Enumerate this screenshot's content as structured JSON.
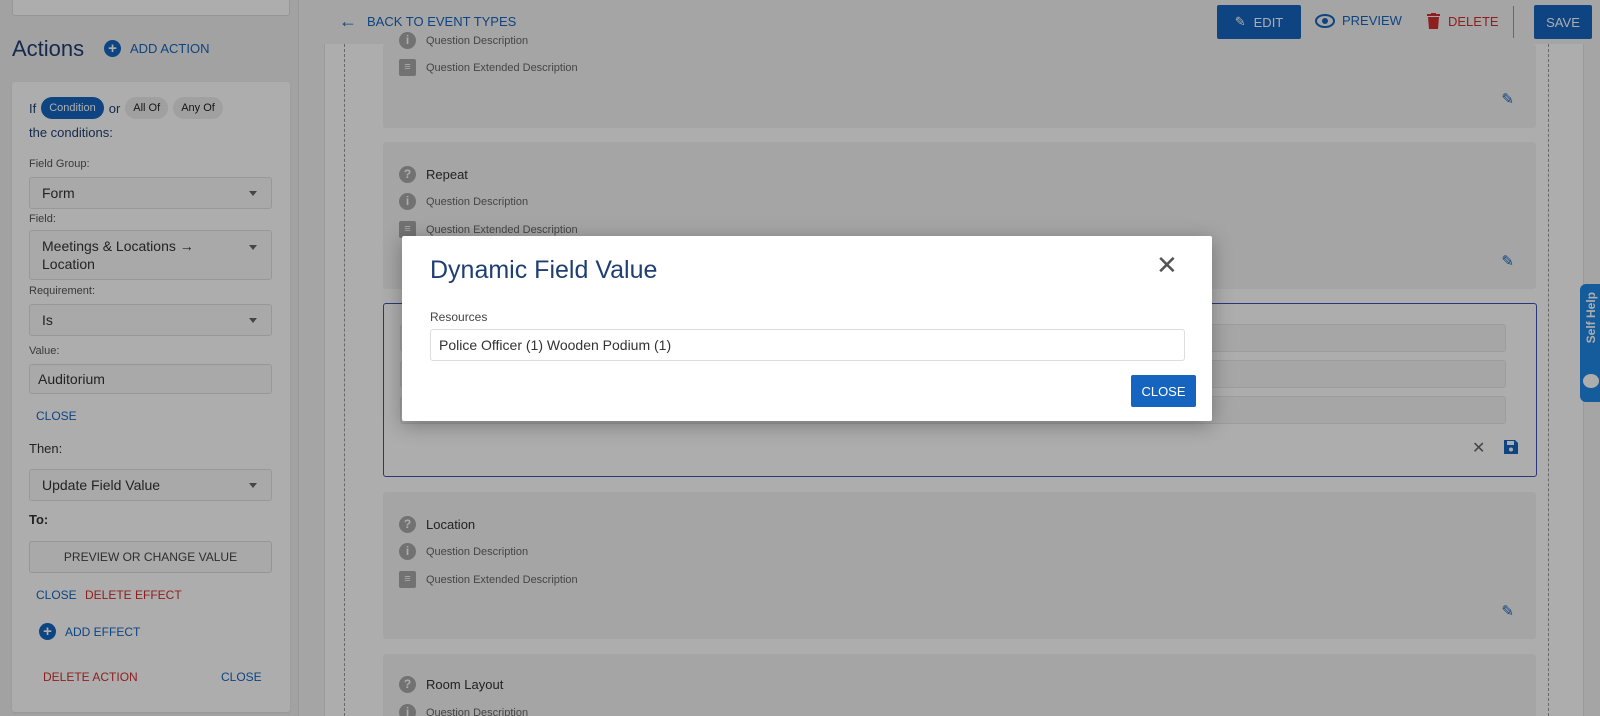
{
  "sidebar": {
    "title": "Actions",
    "add_action": "ADD ACTION",
    "condition": {
      "prefix": "If",
      "chip_condition": "Condition",
      "or": "or",
      "chip_all": "All Of",
      "chip_any": "Any Of",
      "suffix": "the conditions:"
    },
    "field_group_label": "Field Group:",
    "field_group_value": "Form",
    "field_label": "Field:",
    "field_value": "Meetings & Locations → Location",
    "requirement_label": "Requirement:",
    "requirement_value": "Is",
    "value_label": "Value:",
    "value_value": "Auditorium",
    "close_1": "CLOSE",
    "then_label": "Then:",
    "then_value": "Update Field Value",
    "to_label": "To:",
    "preview_change": "PREVIEW OR CHANGE VALUE",
    "close_2": "CLOSE",
    "delete_effect": "DELETE EFFECT",
    "add_effect": "ADD EFFECT",
    "delete_action": "DELETE ACTION",
    "close_3": "CLOSE"
  },
  "topbar": {
    "back": "BACK TO EVENT TYPES",
    "edit": "EDIT",
    "preview": "PREVIEW",
    "delete": "DELETE",
    "save": "SAVE"
  },
  "questions": [
    {
      "desc": "Question Description",
      "ext": "Question Extended Description"
    },
    {
      "title": "Repeat",
      "desc": "Question Description",
      "ext": "Question Extended Description"
    },
    {
      "title": "Location",
      "desc": "Question Description",
      "ext": "Question Extended Description"
    },
    {
      "title": "Room Layout",
      "desc": "Question Description"
    }
  ],
  "modal": {
    "title": "Dynamic Field Value",
    "label": "Resources",
    "value": "Police Officer (1) Wooden Podium (1)",
    "close": "CLOSE"
  },
  "self_help": "Self Help",
  "icons": {
    "add_action": "plus-circle-icon",
    "back": "arrow-left-icon",
    "edit": "pencil-icon",
    "preview": "eye-icon",
    "delete": "trash-icon",
    "question": "help-circle-icon",
    "info": "info-circle-icon",
    "extended": "notes-icon",
    "modal_close": "close-icon",
    "save_question": "floppy-icon"
  },
  "colors": {
    "primary": "#1565c0",
    "danger": "#d32f2f",
    "title": "#1f3f73",
    "active_border": "#3f51b5"
  }
}
